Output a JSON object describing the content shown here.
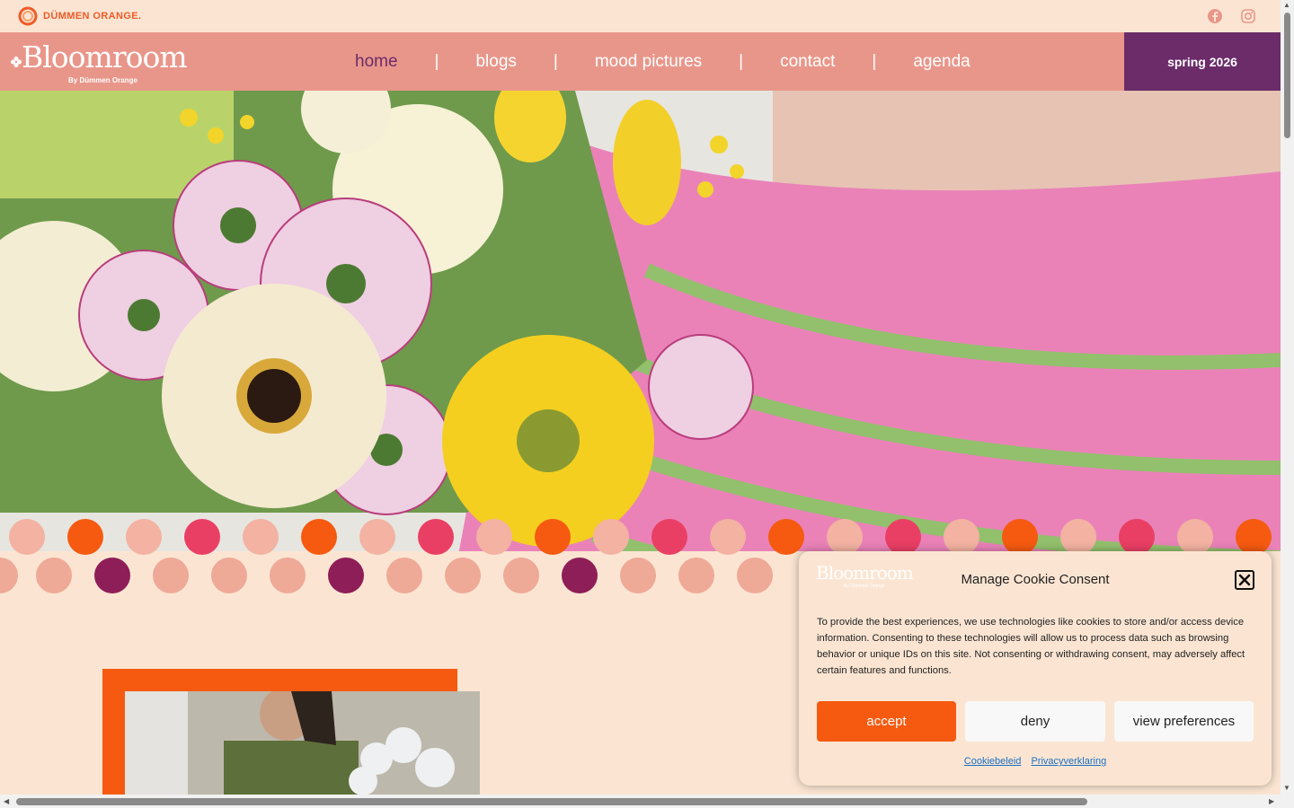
{
  "topbar": {
    "brand_text": "DÜMMEN ORANGE.",
    "social_icons": [
      "facebook-icon",
      "instagram-icon"
    ]
  },
  "nav": {
    "logo_main": "Bloomroom",
    "logo_sub": "By Dümmen Orange",
    "items": [
      {
        "label": "home",
        "active": true
      },
      {
        "label": "blogs",
        "active": false
      },
      {
        "label": "mood pictures",
        "active": false
      },
      {
        "label": "contact",
        "active": false
      },
      {
        "label": "agenda",
        "active": false
      }
    ],
    "cta_label": "spring 2026"
  },
  "cookie": {
    "logo_main": "Bloomroom",
    "logo_sub": "By Dümmen Orange",
    "title": "Manage Cookie Consent",
    "body": "To provide the best experiences, we use technologies like cookies to store and/or access device information. Consenting to these technologies will allow us to process data such as browsing behavior or unique IDs on this site. Not consenting or withdrawing consent, may adversely affect certain features and functions.",
    "accept_label": "accept",
    "deny_label": "deny",
    "preferences_label": "view preferences",
    "link_cookie_policy": "Cookiebeleid",
    "link_privacy": "Privacyverklaring"
  },
  "colors": {
    "background": "#fbe5d2",
    "nav_bg": "#e9968a",
    "cta_bg": "#6b2c69",
    "accent_orange": "#f55a10",
    "link_blue": "#1a6fc4"
  }
}
